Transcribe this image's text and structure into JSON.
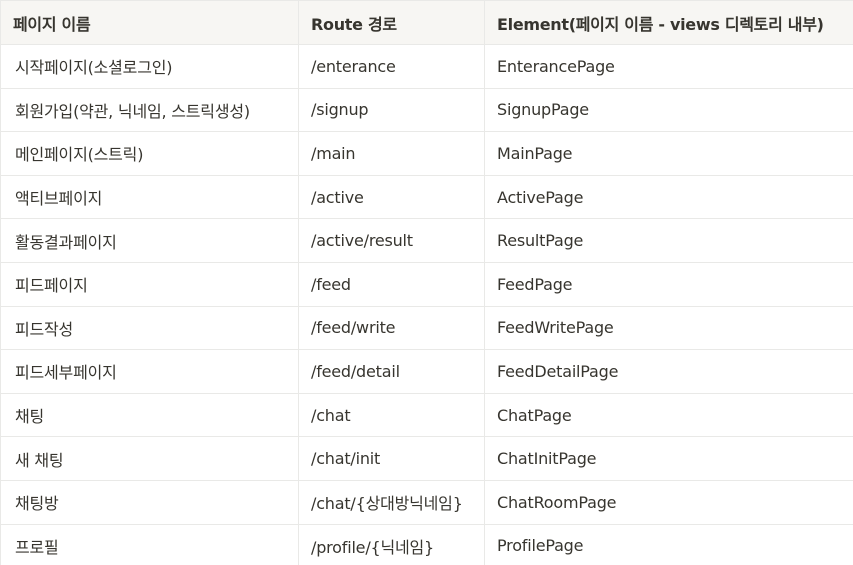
{
  "table": {
    "headers": [
      "페이지 이름",
      "Route 경로",
      "Element(페이지 이름 - views 디렉토리 내부)"
    ],
    "rows": [
      [
        "시작페이지(소셜로그인)",
        "/enterance",
        "EnterancePage"
      ],
      [
        "회원가입(약관, 닉네임, 스트릭생성)",
        "/signup",
        "SignupPage"
      ],
      [
        "메인페이지(스트릭)",
        "/main",
        "MainPage"
      ],
      [
        "액티브페이지",
        "/active",
        "ActivePage"
      ],
      [
        "활동결과페이지",
        "/active/result",
        "ResultPage"
      ],
      [
        "피드페이지",
        "/feed",
        "FeedPage"
      ],
      [
        "피드작성",
        "/feed/write",
        "FeedWritePage"
      ],
      [
        "피드세부페이지",
        "/feed/detail",
        "FeedDetailPage"
      ],
      [
        "채팅",
        "/chat",
        "ChatPage"
      ],
      [
        "새 채팅",
        "/chat/init",
        "ChatInitPage"
      ],
      [
        "채팅방",
        "/chat/{상대방닉네임}",
        "ChatRoomPage"
      ],
      [
        "프로필",
        "/profile/{닉네임}",
        "ProfilePage"
      ]
    ]
  },
  "colors": {
    "header_bg": "#f7f6f3",
    "border": "#e9e9e7",
    "text": "#37352f"
  }
}
